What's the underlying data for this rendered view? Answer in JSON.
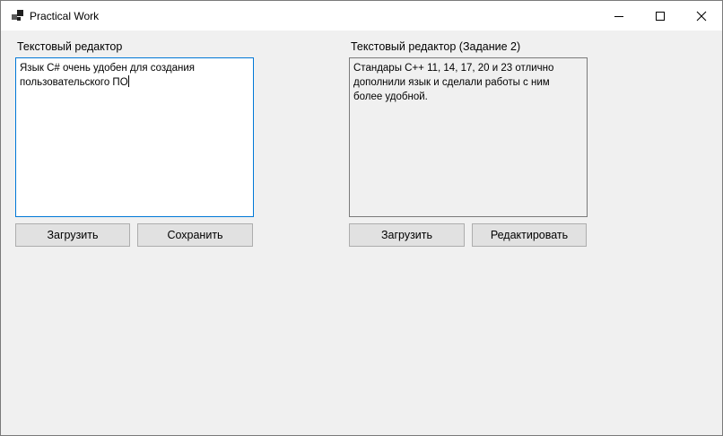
{
  "window": {
    "title": "Practical Work"
  },
  "left_panel": {
    "label": "Текстовый редактор",
    "text": "Язык C# очень удобен для создания\nпользовательского ПО",
    "load_button": "Загрузить",
    "save_button": "Сохранить"
  },
  "right_panel": {
    "label": "Текстовый редактор (Задание 2)",
    "text": "Стандары C++ 11, 14, 17, 20 и 23 отлично\nдополнили язык и сделали работы с ним\nболее удобной.",
    "load_button": "Загрузить",
    "edit_button": "Редактировать"
  },
  "icons": {
    "app": "app-icon",
    "minimize": "minimize-icon",
    "maximize": "maximize-icon",
    "close": "close-icon"
  },
  "colors": {
    "focus_border": "#0078d7",
    "button_bg": "#e1e1e1",
    "window_bg": "#f0f0f0"
  }
}
